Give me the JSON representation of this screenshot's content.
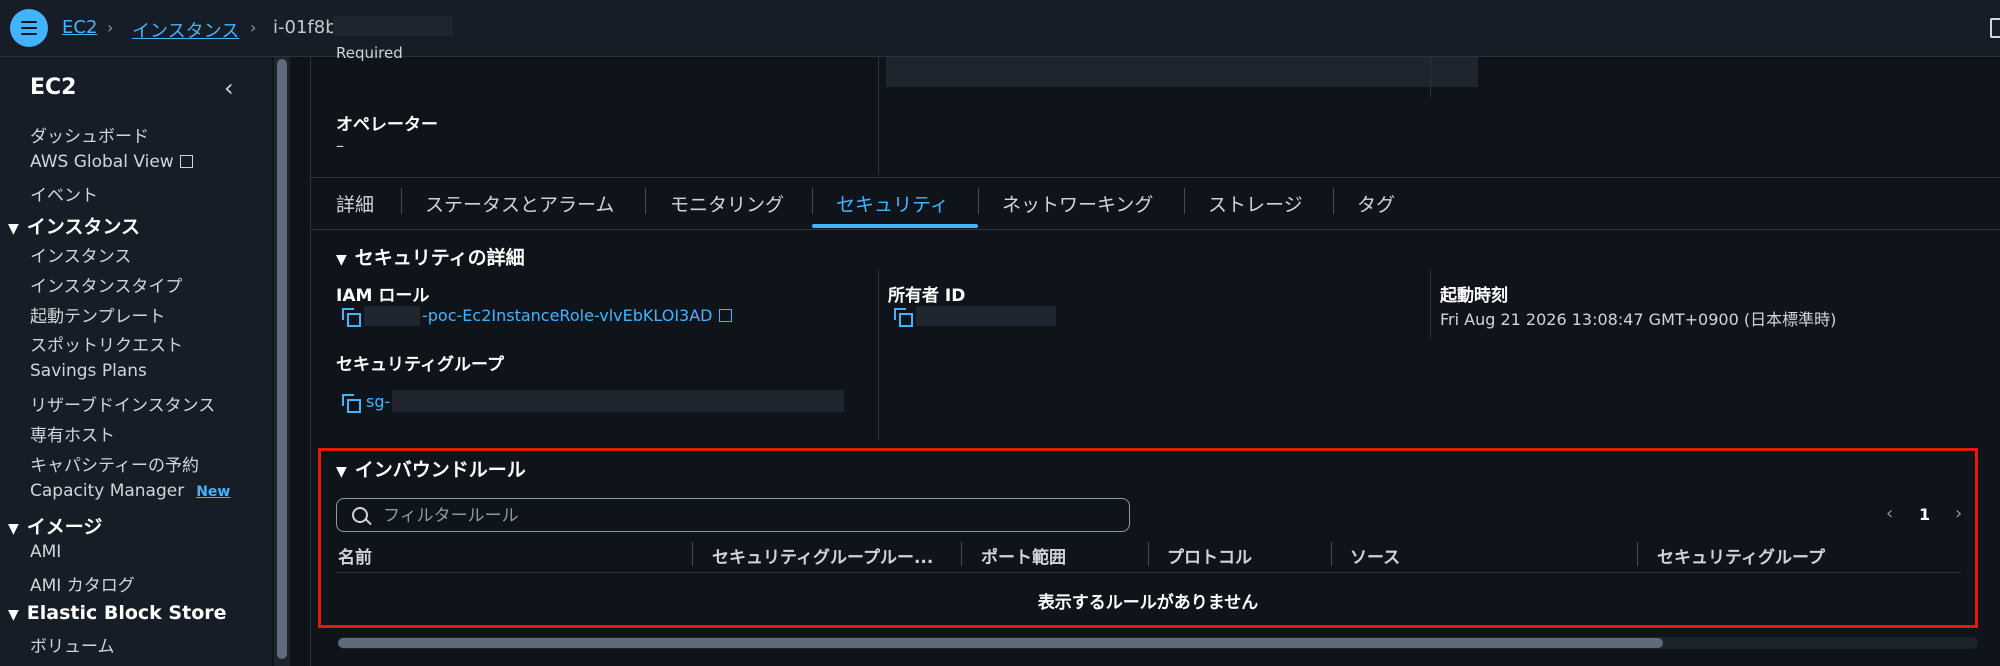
{
  "breadcrumb": {
    "items": [
      "EC2",
      "インスタンス"
    ],
    "current": "i-01f8b"
  },
  "sidebar": {
    "title": "EC2",
    "items_top": [
      "ダッシュボード",
      "AWS Global View",
      "イベント"
    ],
    "section_instances": "インスタンス",
    "instances_items": [
      "インスタンス",
      "インスタンスタイプ",
      "起動テンプレート",
      "スポットリクエスト",
      "Savings Plans",
      "リザーブドインスタンス",
      "専有ホスト",
      "キャパシティーの予約",
      "Capacity Manager"
    ],
    "new_badge": "New",
    "section_images": "イメージ",
    "images_items": [
      "AMI",
      "AMI カタログ"
    ],
    "section_ebs": "Elastic Block Store",
    "ebs_items": [
      "ボリューム"
    ]
  },
  "top_partial": {
    "required_text": "Required",
    "operator_label": "オペレーター",
    "operator_value": "–"
  },
  "tabs": [
    "詳細",
    "ステータスとアラーム",
    "モニタリング",
    "セキュリティ",
    "ネットワーキング",
    "ストレージ",
    "タグ"
  ],
  "active_tab": "セキュリティ",
  "security_details": {
    "heading": "セキュリティの詳細",
    "iam_role_label": "IAM ロール",
    "iam_role_value": "-poc-Ec2InstanceRole-vlvEbKLOI3AD",
    "owner_id_label": "所有者 ID",
    "launch_time_label": "起動時刻",
    "launch_time_value": "Fri Aug 21 2026 13:08:47 GMT+0900 (日本標準時)",
    "security_group_label": "セキュリティグループ",
    "security_group_value": "sg-"
  },
  "inbound_rules": {
    "heading": "インバウンドルール",
    "filter_placeholder": "フィルタールール",
    "page": "1",
    "columns": [
      "名前",
      "セキュリティグループルー...",
      "ポート範囲",
      "プロトコル",
      "ソース",
      "セキュリティグループ"
    ],
    "empty_message": "表示するルールがありません"
  },
  "colors": {
    "accent": "#42b4ff",
    "background": "#0f141a",
    "panel": "#161d26",
    "highlight": "#e8170c"
  },
  "icons": [
    "menu-icon",
    "chevron-right-icon",
    "chevron-left-icon",
    "external-link-icon",
    "caret-down-icon",
    "copy-icon",
    "search-icon"
  ]
}
